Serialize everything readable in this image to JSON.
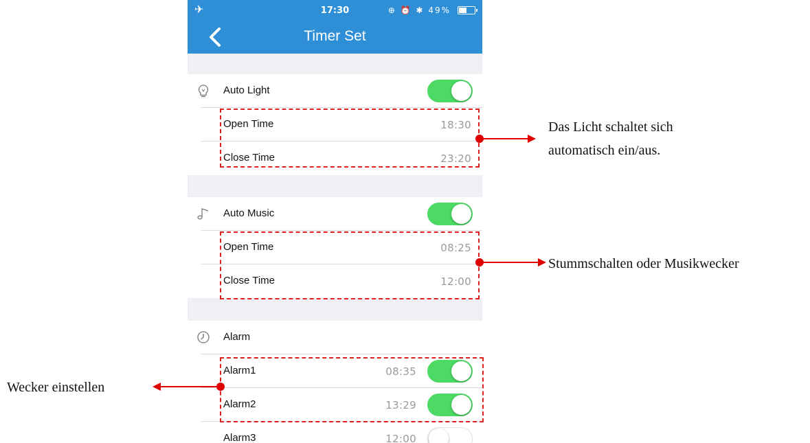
{
  "status_bar": {
    "time": "17:30",
    "icons": "⊕ ⏰ ✱ 49%",
    "battery_percent": 49
  },
  "nav": {
    "title": "Timer Set"
  },
  "auto_light": {
    "label": "Auto Light",
    "icon": "lightbulb-icon",
    "enabled": true,
    "rows": [
      {
        "label": "Open Time",
        "value": "18:30"
      },
      {
        "label": "Close Time",
        "value": "23:20"
      }
    ]
  },
  "auto_music": {
    "label": "Auto Music",
    "icon": "music-note-icon",
    "enabled": true,
    "rows": [
      {
        "label": "Open Time",
        "value": "08:25"
      },
      {
        "label": "Close Time",
        "value": "12:00"
      }
    ]
  },
  "alarm": {
    "label": "Alarm",
    "icon": "clock-icon",
    "rows": [
      {
        "label": "Alarm1",
        "value": "08:35",
        "enabled": true
      },
      {
        "label": "Alarm2",
        "value": "13:29",
        "enabled": true
      },
      {
        "label": "Alarm3",
        "value": "12:00",
        "enabled": false
      }
    ]
  },
  "annotations": {
    "light_line1": "Das Licht schaltet sich",
    "light_line2": "automatisch ein/aus.",
    "music": "Stummschalten oder Musikwecker",
    "alarm": "Wecker einstellen"
  },
  "colors": {
    "nav": "#2f8fd6",
    "toggle_on": "#4cd964",
    "annotation": "#e00000"
  }
}
